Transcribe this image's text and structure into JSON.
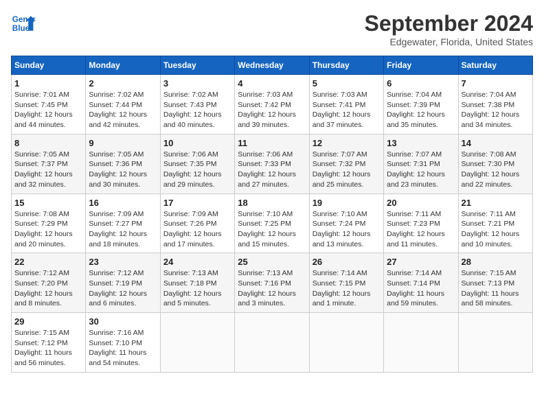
{
  "header": {
    "logo_line1": "General",
    "logo_line2": "Blue",
    "month": "September 2024",
    "location": "Edgewater, Florida, United States"
  },
  "days_of_week": [
    "Sunday",
    "Monday",
    "Tuesday",
    "Wednesday",
    "Thursday",
    "Friday",
    "Saturday"
  ],
  "weeks": [
    [
      {
        "num": "1",
        "sunrise": "7:01 AM",
        "sunset": "7:45 PM",
        "daylight": "12 hours and 44 minutes."
      },
      {
        "num": "2",
        "sunrise": "7:02 AM",
        "sunset": "7:44 PM",
        "daylight": "12 hours and 42 minutes."
      },
      {
        "num": "3",
        "sunrise": "7:02 AM",
        "sunset": "7:43 PM",
        "daylight": "12 hours and 40 minutes."
      },
      {
        "num": "4",
        "sunrise": "7:03 AM",
        "sunset": "7:42 PM",
        "daylight": "12 hours and 39 minutes."
      },
      {
        "num": "5",
        "sunrise": "7:03 AM",
        "sunset": "7:41 PM",
        "daylight": "12 hours and 37 minutes."
      },
      {
        "num": "6",
        "sunrise": "7:04 AM",
        "sunset": "7:39 PM",
        "daylight": "12 hours and 35 minutes."
      },
      {
        "num": "7",
        "sunrise": "7:04 AM",
        "sunset": "7:38 PM",
        "daylight": "12 hours and 34 minutes."
      }
    ],
    [
      {
        "num": "8",
        "sunrise": "7:05 AM",
        "sunset": "7:37 PM",
        "daylight": "12 hours and 32 minutes."
      },
      {
        "num": "9",
        "sunrise": "7:05 AM",
        "sunset": "7:36 PM",
        "daylight": "12 hours and 30 minutes."
      },
      {
        "num": "10",
        "sunrise": "7:06 AM",
        "sunset": "7:35 PM",
        "daylight": "12 hours and 29 minutes."
      },
      {
        "num": "11",
        "sunrise": "7:06 AM",
        "sunset": "7:33 PM",
        "daylight": "12 hours and 27 minutes."
      },
      {
        "num": "12",
        "sunrise": "7:07 AM",
        "sunset": "7:32 PM",
        "daylight": "12 hours and 25 minutes."
      },
      {
        "num": "13",
        "sunrise": "7:07 AM",
        "sunset": "7:31 PM",
        "daylight": "12 hours and 23 minutes."
      },
      {
        "num": "14",
        "sunrise": "7:08 AM",
        "sunset": "7:30 PM",
        "daylight": "12 hours and 22 minutes."
      }
    ],
    [
      {
        "num": "15",
        "sunrise": "7:08 AM",
        "sunset": "7:29 PM",
        "daylight": "12 hours and 20 minutes."
      },
      {
        "num": "16",
        "sunrise": "7:09 AM",
        "sunset": "7:27 PM",
        "daylight": "12 hours and 18 minutes."
      },
      {
        "num": "17",
        "sunrise": "7:09 AM",
        "sunset": "7:26 PM",
        "daylight": "12 hours and 17 minutes."
      },
      {
        "num": "18",
        "sunrise": "7:10 AM",
        "sunset": "7:25 PM",
        "daylight": "12 hours and 15 minutes."
      },
      {
        "num": "19",
        "sunrise": "7:10 AM",
        "sunset": "7:24 PM",
        "daylight": "12 hours and 13 minutes."
      },
      {
        "num": "20",
        "sunrise": "7:11 AM",
        "sunset": "7:23 PM",
        "daylight": "12 hours and 11 minutes."
      },
      {
        "num": "21",
        "sunrise": "7:11 AM",
        "sunset": "7:21 PM",
        "daylight": "12 hours and 10 minutes."
      }
    ],
    [
      {
        "num": "22",
        "sunrise": "7:12 AM",
        "sunset": "7:20 PM",
        "daylight": "12 hours and 8 minutes."
      },
      {
        "num": "23",
        "sunrise": "7:12 AM",
        "sunset": "7:19 PM",
        "daylight": "12 hours and 6 minutes."
      },
      {
        "num": "24",
        "sunrise": "7:13 AM",
        "sunset": "7:18 PM",
        "daylight": "12 hours and 5 minutes."
      },
      {
        "num": "25",
        "sunrise": "7:13 AM",
        "sunset": "7:16 PM",
        "daylight": "12 hours and 3 minutes."
      },
      {
        "num": "26",
        "sunrise": "7:14 AM",
        "sunset": "7:15 PM",
        "daylight": "12 hours and 1 minute."
      },
      {
        "num": "27",
        "sunrise": "7:14 AM",
        "sunset": "7:14 PM",
        "daylight": "11 hours and 59 minutes."
      },
      {
        "num": "28",
        "sunrise": "7:15 AM",
        "sunset": "7:13 PM",
        "daylight": "11 hours and 58 minutes."
      }
    ],
    [
      {
        "num": "29",
        "sunrise": "7:15 AM",
        "sunset": "7:12 PM",
        "daylight": "11 hours and 56 minutes."
      },
      {
        "num": "30",
        "sunrise": "7:16 AM",
        "sunset": "7:10 PM",
        "daylight": "11 hours and 54 minutes."
      },
      null,
      null,
      null,
      null,
      null
    ]
  ]
}
